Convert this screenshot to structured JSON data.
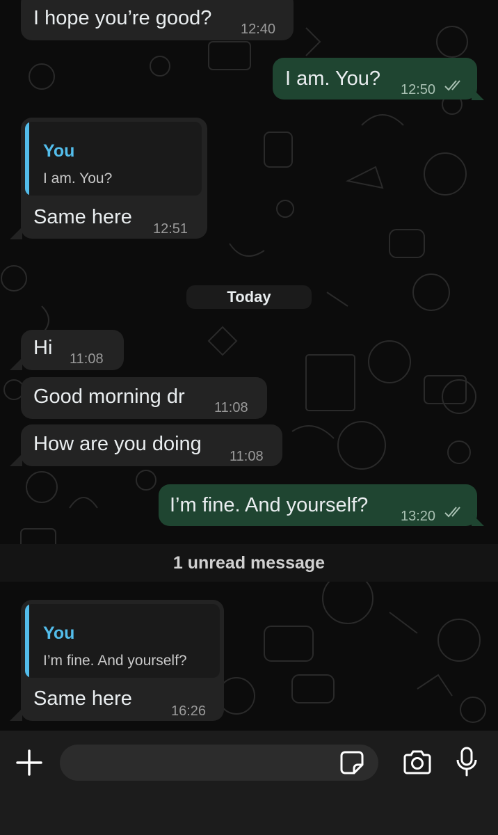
{
  "messages": [
    {
      "direction": "in",
      "text": "I hope you’re good?",
      "time": "12:40"
    },
    {
      "direction": "out",
      "text": "I am. You?",
      "time": "12:50",
      "status": "read"
    },
    {
      "direction": "in",
      "quote": {
        "author": "You",
        "text": "I am. You?"
      },
      "text": "Same here",
      "time": "12:51"
    },
    {
      "direction": "in",
      "text": "Hi",
      "time": "11:08"
    },
    {
      "direction": "in",
      "text": "Good morning dr",
      "time": "11:08"
    },
    {
      "direction": "in",
      "text": "How are you doing",
      "time": "11:08"
    },
    {
      "direction": "out",
      "text": "I’m fine. And yourself?",
      "time": "13:20",
      "status": "read"
    },
    {
      "direction": "in",
      "quote": {
        "author": "You",
        "text": "I’m fine. And yourself?"
      },
      "text": "Same here",
      "time": "16:26"
    }
  ],
  "date_chip": "Today",
  "unread_banner": "1 unread message",
  "composer": {
    "placeholder": "",
    "icons": [
      "plus-icon",
      "sticker-icon",
      "camera-icon",
      "microphone-icon"
    ]
  },
  "colors": {
    "incoming_bubble": "#232323",
    "outgoing_bubble": "#1f4531",
    "quote_accent": "#53bdeb",
    "read_ticks": "#a9c1b3"
  }
}
